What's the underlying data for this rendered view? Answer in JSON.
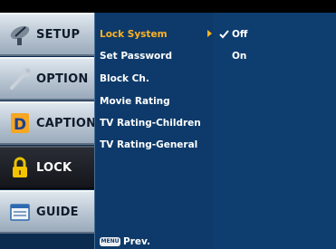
{
  "tabs": [
    {
      "label": "SETUP",
      "icon": "satellite-dish-icon",
      "active": false
    },
    {
      "label": "OPTION",
      "icon": "wrench-icon",
      "active": false
    },
    {
      "label": "CAPTION",
      "icon": "caption-icon",
      "active": false
    },
    {
      "label": "LOCK",
      "icon": "padlock-icon",
      "active": true
    },
    {
      "label": "GUIDE",
      "icon": "guide-icon",
      "active": false
    }
  ],
  "menu": {
    "items": [
      {
        "label": "Lock System",
        "selected": true
      },
      {
        "label": "Set Password",
        "selected": false
      },
      {
        "label": "Block Ch.",
        "selected": false
      },
      {
        "label": "Movie Rating",
        "selected": false
      },
      {
        "label": "TV Rating-Children",
        "selected": false
      },
      {
        "label": "TV Rating-General",
        "selected": false
      }
    ],
    "options": [
      {
        "label": "Off",
        "checked": true
      },
      {
        "label": "On",
        "checked": false
      }
    ]
  },
  "footer": {
    "key_label": "MENU",
    "text": "Prev."
  },
  "colors": {
    "selected": "#ffb321",
    "panel": "#0d3a6a",
    "active_tab": "#14161b"
  }
}
